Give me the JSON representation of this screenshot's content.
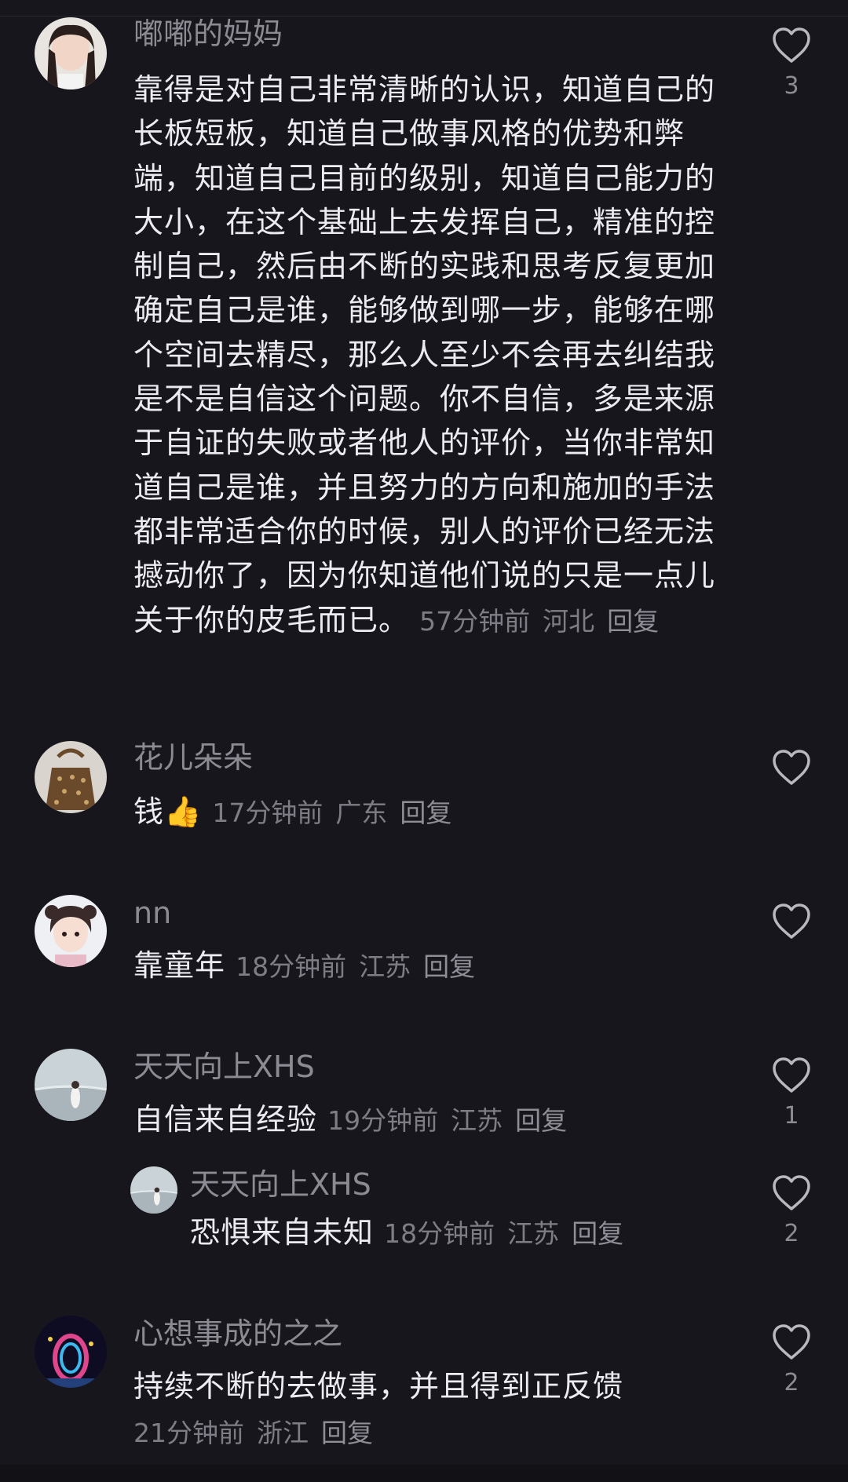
{
  "comments": [
    {
      "username": "嘟嘟的妈妈",
      "text": "靠得是对自己非常清晰的认识，知道自己的长板短板，知道自己做事风格的优势和弊端，知道自己目前的级别，知道自己能力的大小，在这个基础上去发挥自己，精准的控制自己，然后由不断的实践和思考反复更加确定自己是谁，能够做到哪一步，能够在哪个空间去精尽，那么人至少不会再去纠结我是不是自信这个问题。你不自信，多是来源于自证的失败或者他人的评价，当你非常知道自己是谁，并且努力的方向和施加的手法都非常适合你的时候，别人的评价已经无法撼动你了，因为你知道他们说的只是一点儿关于你的皮毛而已。",
      "time": "57分钟前",
      "location": "河北",
      "reply": "回复",
      "likes": "3"
    },
    {
      "username": "花儿朵朵",
      "text": "钱👍",
      "time": "17分钟前",
      "location": "广东",
      "reply": "回复",
      "likes": ""
    },
    {
      "username": "nn",
      "text": "靠童年",
      "time": "18分钟前",
      "location": "江苏",
      "reply": "回复",
      "likes": ""
    },
    {
      "username": "天天向上XHS",
      "text": "自信来自经验",
      "time": "19分钟前",
      "location": "江苏",
      "reply": "回复",
      "likes": "1"
    },
    {
      "username": "心想事成的之之",
      "text": "持续不断的去做事，并且得到正反馈",
      "time": "21分钟前",
      "location": "浙江",
      "reply": "回复",
      "likes": "2"
    }
  ],
  "sub_reply": {
    "username": "天天向上XHS",
    "text": "恐惧来自未知",
    "time": "18分钟前",
    "location": "江苏",
    "reply": "回复",
    "likes": "2"
  },
  "colors": {
    "background": "#17161c",
    "username": "#8c8b93",
    "body": "#ecebf1",
    "meta": "#7e7d86"
  },
  "icons": {
    "like": "heart-outline-icon"
  }
}
